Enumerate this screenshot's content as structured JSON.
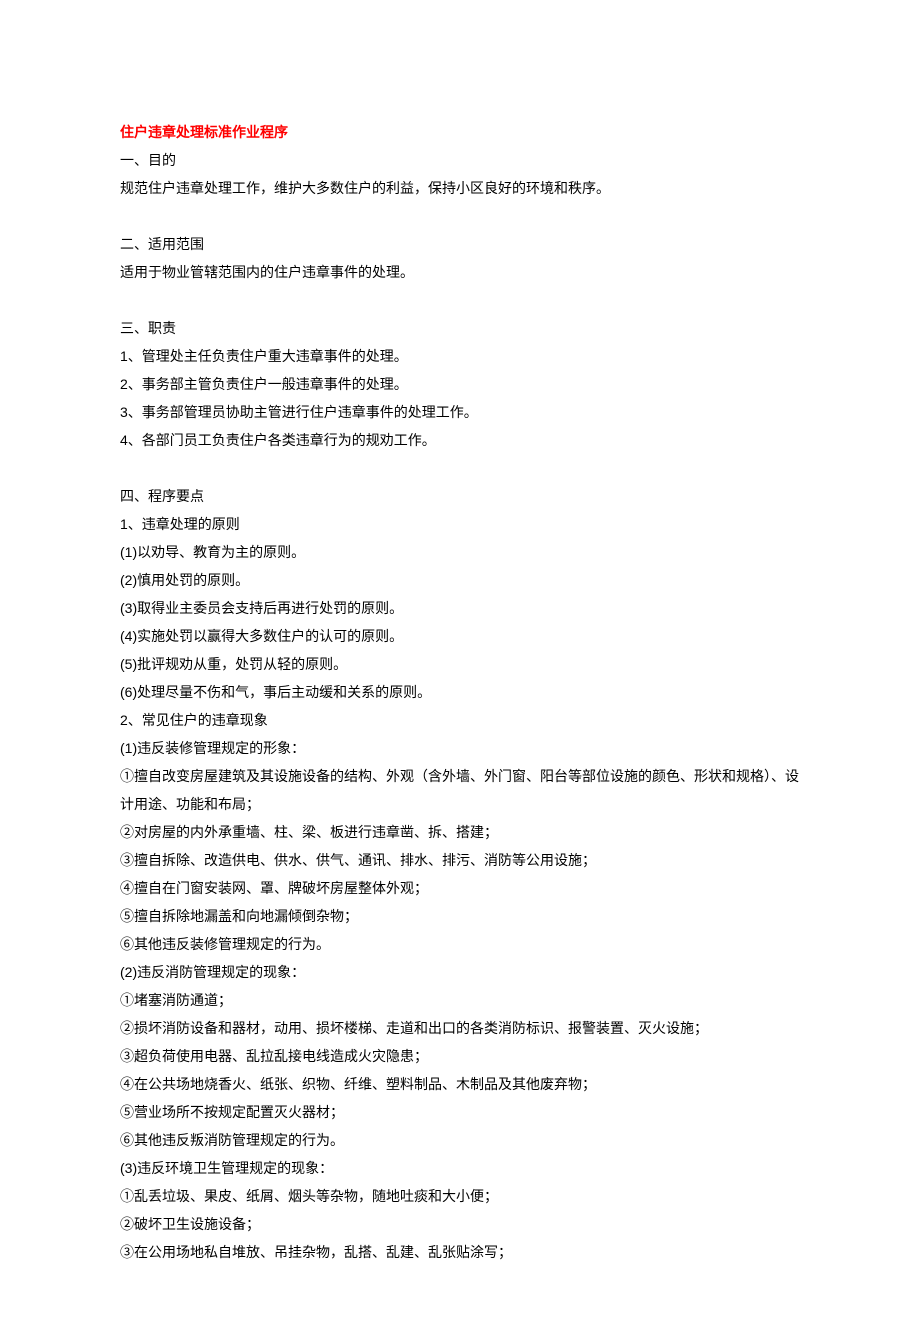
{
  "title": "住户违章处理标准作业程序",
  "s1": {
    "h": "一、目的",
    "p1": "规范住户违章处理工作，维护大多数住户的利益，保持小区良好的环境和秩序。"
  },
  "s2": {
    "h": "二、适用范围",
    "p1": "适用于物业管辖范围内的住户违章事件的处理。"
  },
  "s3": {
    "h": "三、职责",
    "i1": "1、管理处主任负责住户重大违章事件的处理。",
    "i2": "2、事务部主管负责住户一般违章事件的处理。",
    "i3": "3、事务部管理员协助主管进行住户违章事件的处理工作。",
    "i4": "4、各部门员工负责住户各类违章行为的规劝工作。"
  },
  "s4": {
    "h": "四、程序要点",
    "g1": {
      "h": "1、违章处理的原则",
      "i1": "(1)以劝导、教育为主的原则。",
      "i2": "(2)慎用处罚的原则。",
      "i3": "(3)取得业主委员会支持后再进行处罚的原则。",
      "i4": "(4)实施处罚以赢得大多数住户的认可的原则。",
      "i5": "(5)批评规劝从重，处罚从轻的原则。",
      "i6": "(6)处理尽量不伤和气，事后主动缓和关系的原则。"
    },
    "g2": {
      "h": "2、常见住户的违章现象",
      "c1": {
        "h": "(1)违反装修管理规定的形象：",
        "i1": "①擅自改变房屋建筑及其设施设备的结构、外观（含外墙、外门窗、阳台等部位设施的颜色、形状和规格）、设计用途、功能和布局；",
        "i2": "②对房屋的内外承重墙、柱、梁、板进行违章凿、拆、搭建；",
        "i3": "③擅自拆除、改造供电、供水、供气、通讯、排水、排污、消防等公用设施；",
        "i4": "④擅自在门窗安装网、罩、牌破坏房屋整体外观；",
        "i5": "⑤擅自拆除地漏盖和向地漏倾倒杂物；",
        "i6": "⑥其他违反装修管理规定的行为。"
      },
      "c2": {
        "h": "(2)违反消防管理规定的现象：",
        "i1": "①堵塞消防通道；",
        "i2": "②损坏消防设备和器材，动用、损坏楼梯、走道和出口的各类消防标识、报警装置、灭火设施；",
        "i3": "③超负荷使用电器、乱拉乱接电线造成火灾隐患；",
        "i4": "④在公共场地烧香火、纸张、织物、纤维、塑料制品、木制品及其他废弃物；",
        "i5": "⑤营业场所不按规定配置灭火器材；",
        "i6": "⑥其他违反叛消防管理规定的行为。"
      },
      "c3": {
        "h": "(3)违反环境卫生管理规定的现象：",
        "i1": "①乱丢垃圾、果皮、纸屑、烟头等杂物，随地吐痰和大小便；",
        "i2": "②破坏卫生设施设备；",
        "i3": "③在公用场地私自堆放、吊挂杂物，乱搭、乱建、乱张贴涂写；"
      }
    }
  }
}
